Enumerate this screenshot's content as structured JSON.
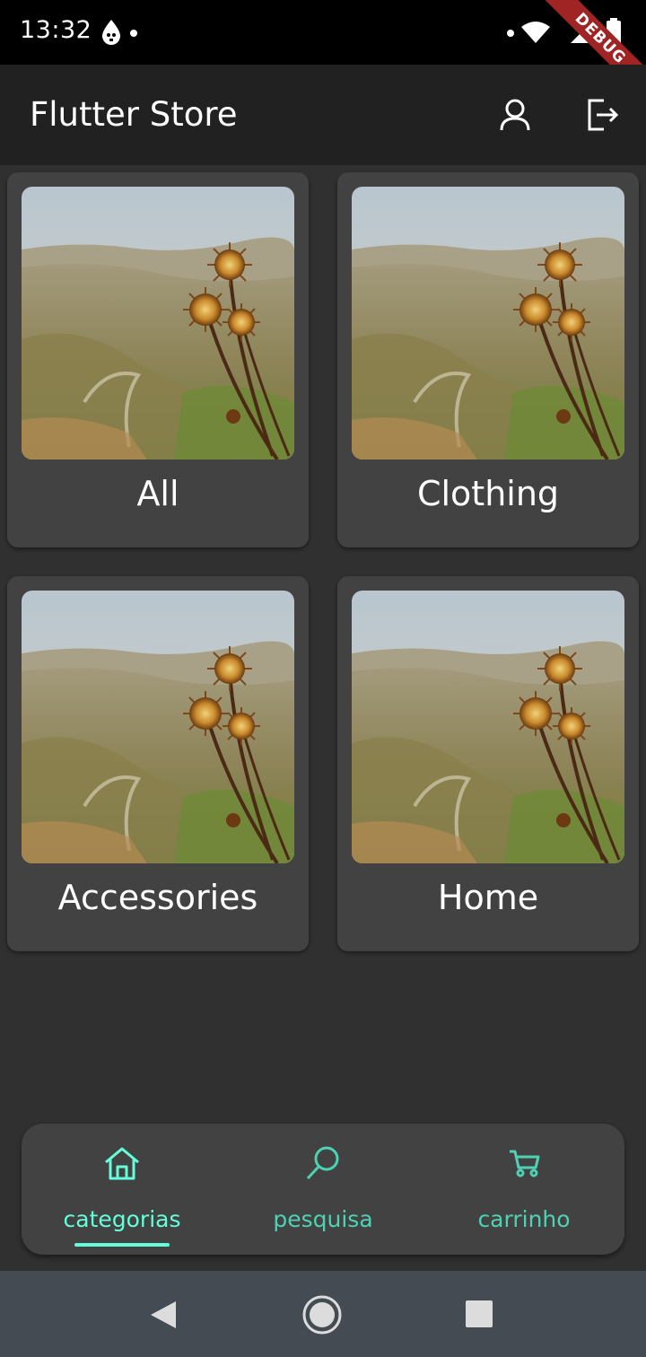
{
  "status_bar": {
    "time": "13:32",
    "debug_label": "DEBUG",
    "icons": [
      "notification-drop-icon",
      "dot-icon",
      "wifi-icon",
      "signal-icon",
      "battery-icon"
    ]
  },
  "app_bar": {
    "title": "Flutter Store",
    "actions": [
      {
        "name": "account-icon",
        "label": ""
      },
      {
        "name": "logout-icon",
        "label": ""
      }
    ]
  },
  "categories": [
    {
      "label": "All",
      "image": "thistle-landscape-photo"
    },
    {
      "label": "Clothing",
      "image": "thistle-landscape-photo"
    },
    {
      "label": "Accessories",
      "image": "thistle-landscape-photo"
    },
    {
      "label": "Home",
      "image": "thistle-landscape-photo"
    }
  ],
  "bottom_nav": {
    "items": [
      {
        "label": "categorias",
        "icon": "home-icon",
        "active": true
      },
      {
        "label": "pesquisa",
        "icon": "search-icon",
        "active": false
      },
      {
        "label": "carrinho",
        "icon": "cart-icon",
        "active": false
      }
    ]
  },
  "colors": {
    "accent": "#64ffda",
    "accent_muted": "#4fd1b4",
    "background": "#303030",
    "app_bar": "#212121",
    "card": "#424242",
    "system_nav": "#444b52",
    "debug_banner": "#a02424"
  },
  "system_nav": {
    "buttons": [
      "back-icon",
      "home-circle-icon",
      "recents-icon"
    ]
  }
}
